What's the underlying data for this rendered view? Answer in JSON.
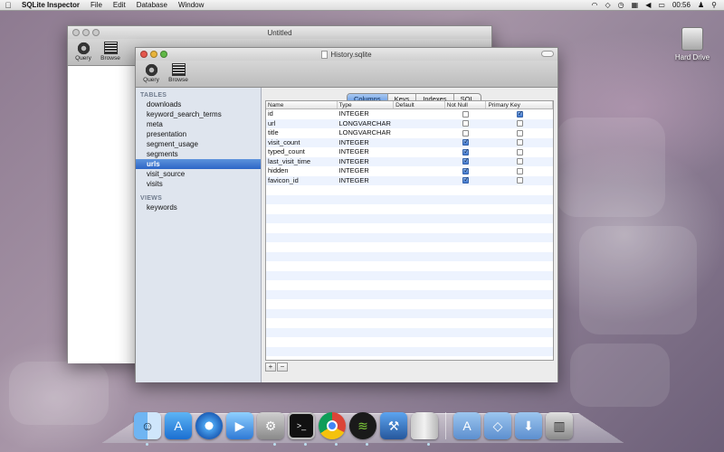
{
  "menubar": {
    "app_name": "SQLite Inspector",
    "menus": [
      "File",
      "Edit",
      "Database",
      "Window"
    ],
    "clock": "00:56"
  },
  "desktop": {
    "hard_drive_label": "Hard Drive"
  },
  "back_window": {
    "title": "Untitled",
    "toolbar": {
      "query_label": "Query",
      "browse_label": "Browse"
    }
  },
  "front_window": {
    "title": "History.sqlite",
    "toolbar": {
      "query_label": "Query",
      "browse_label": "Browse"
    },
    "sidebar": {
      "tables_header": "TABLES",
      "tables": [
        "downloads",
        "keyword_search_terms",
        "meta",
        "presentation",
        "segment_usage",
        "segments",
        "urls",
        "visit_source",
        "visits"
      ],
      "selected_index": 6,
      "views_header": "VIEWS",
      "views": [
        "keywords"
      ]
    },
    "tabs": [
      "Columns",
      "Keys",
      "Indexes",
      "SQL"
    ],
    "selected_tab": 0,
    "table": {
      "headers": [
        "Name",
        "Type",
        "Default",
        "Not Null",
        "Primary Key"
      ],
      "rows": [
        {
          "name": "id",
          "type": "INTEGER",
          "default": "",
          "not_null": false,
          "primary_key": true
        },
        {
          "name": "url",
          "type": "LONGVARCHAR",
          "default": "",
          "not_null": false,
          "primary_key": false
        },
        {
          "name": "title",
          "type": "LONGVARCHAR",
          "default": "",
          "not_null": false,
          "primary_key": false
        },
        {
          "name": "visit_count",
          "type": "INTEGER",
          "default": "",
          "not_null": true,
          "primary_key": false
        },
        {
          "name": "typed_count",
          "type": "INTEGER",
          "default": "",
          "not_null": true,
          "primary_key": false
        },
        {
          "name": "last_visit_time",
          "type": "INTEGER",
          "default": "",
          "not_null": true,
          "primary_key": false
        },
        {
          "name": "hidden",
          "type": "INTEGER",
          "default": "",
          "not_null": true,
          "primary_key": false
        },
        {
          "name": "favicon_id",
          "type": "INTEGER",
          "default": "",
          "not_null": true,
          "primary_key": false
        }
      ]
    },
    "add_label": "+",
    "remove_label": "−"
  },
  "dock": {
    "apps": [
      "finder-icon",
      "app-store-icon",
      "safari-icon",
      "facetime-icon",
      "system-preferences-icon",
      "terminal-icon",
      "chrome-icon",
      "spotify-icon",
      "xcode-icon",
      "sqlite-inspector-icon"
    ],
    "folders": [
      "applications-folder-icon",
      "dropbox-folder-icon",
      "downloads-folder-icon",
      "trash-icon"
    ]
  }
}
